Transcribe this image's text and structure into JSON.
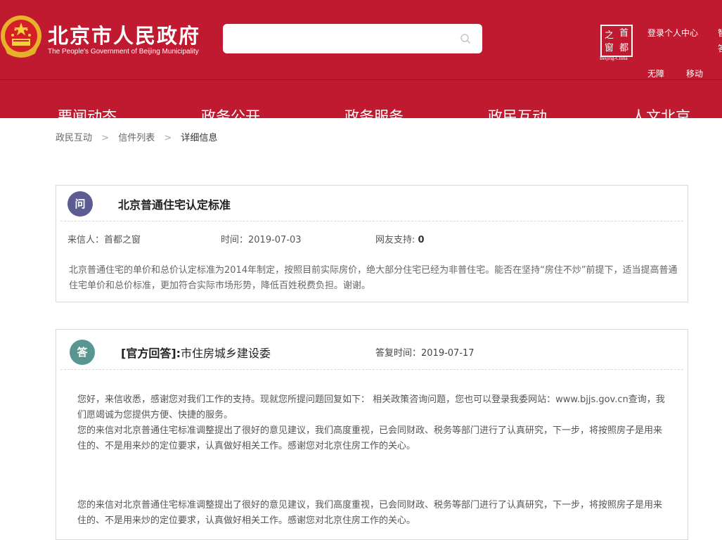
{
  "header": {
    "title": "北京市人民政府",
    "subtitle": "The People's Government of Beijing Municipality",
    "search": {
      "value": "",
      "placeholder": ""
    },
    "capital_logo": {
      "chars": [
        "首",
        "之",
        "都",
        "窗"
      ],
      "caption": "Beijing-China"
    },
    "links": {
      "login": "登录个人中心",
      "accessibility": "无障",
      "mobile": "移动",
      "edge_top": "智",
      "edge_bottom": "答"
    },
    "nav": [
      "要闻动态",
      "政务公开",
      "政务服务",
      "政民互动",
      "人文北京"
    ]
  },
  "breadcrumb": {
    "items": [
      "政民互动",
      "信件列表",
      "详细信息"
    ],
    "separator": ">"
  },
  "question": {
    "badge": "问",
    "title": "北京普通住宅认定标准",
    "sender": "来信人：首都之窗",
    "time": "时间：2019-07-03",
    "support_label": "网友支持:",
    "support_count": "0",
    "body": "北京普通住宅的单价和总价认定标准为2014年制定，按照目前实际房价，绝大部分住宅已经为非普住宅。能否在坚持“房住不炒”前提下，适当提高普通住宅单价和总价标准，更加符合实际市场形势，降低百姓税费负担。谢谢。"
  },
  "answer": {
    "badge": "答",
    "label": "[官方回答]:",
    "department": "市住房城乡建设委",
    "time": "答复时间：2019-07-17",
    "para1": "您好，来信收悉，感谢您对我们工作的支持。现就您所提问题回复如下： 相关政策咨询问题，您也可以登录我委网站：www.bjjs.gov.cn查询，我们愿竭诚为您提供方便、快捷的服务。",
    "para2": "您的来信对北京普通住宅标准调整提出了很好的意见建议，我们高度重视，已会同财政、税务等部门进行了认真研究，下一步，将按照房子是用来住的、不是用来炒的定位要求，认真做好相关工作。感谢您对北京住房工作的关心。",
    "para3": "您的来信对北京普通住宅标准调整提出了很好的意见建议，我们高度重视，已会同财政、税务等部门进行了认真研究，下一步，将按照房子是用来住的、不是用来炒的定位要求，认真做好相关工作。感谢您对北京住房工作的关心。"
  },
  "colors": {
    "brand_red": "#bf1a2f",
    "question_badge": "#5c5b92",
    "answer_badge": "#5a9690"
  },
  "icons": [
    "national-emblem-icon",
    "search-icon",
    "capital-window-logo"
  ]
}
